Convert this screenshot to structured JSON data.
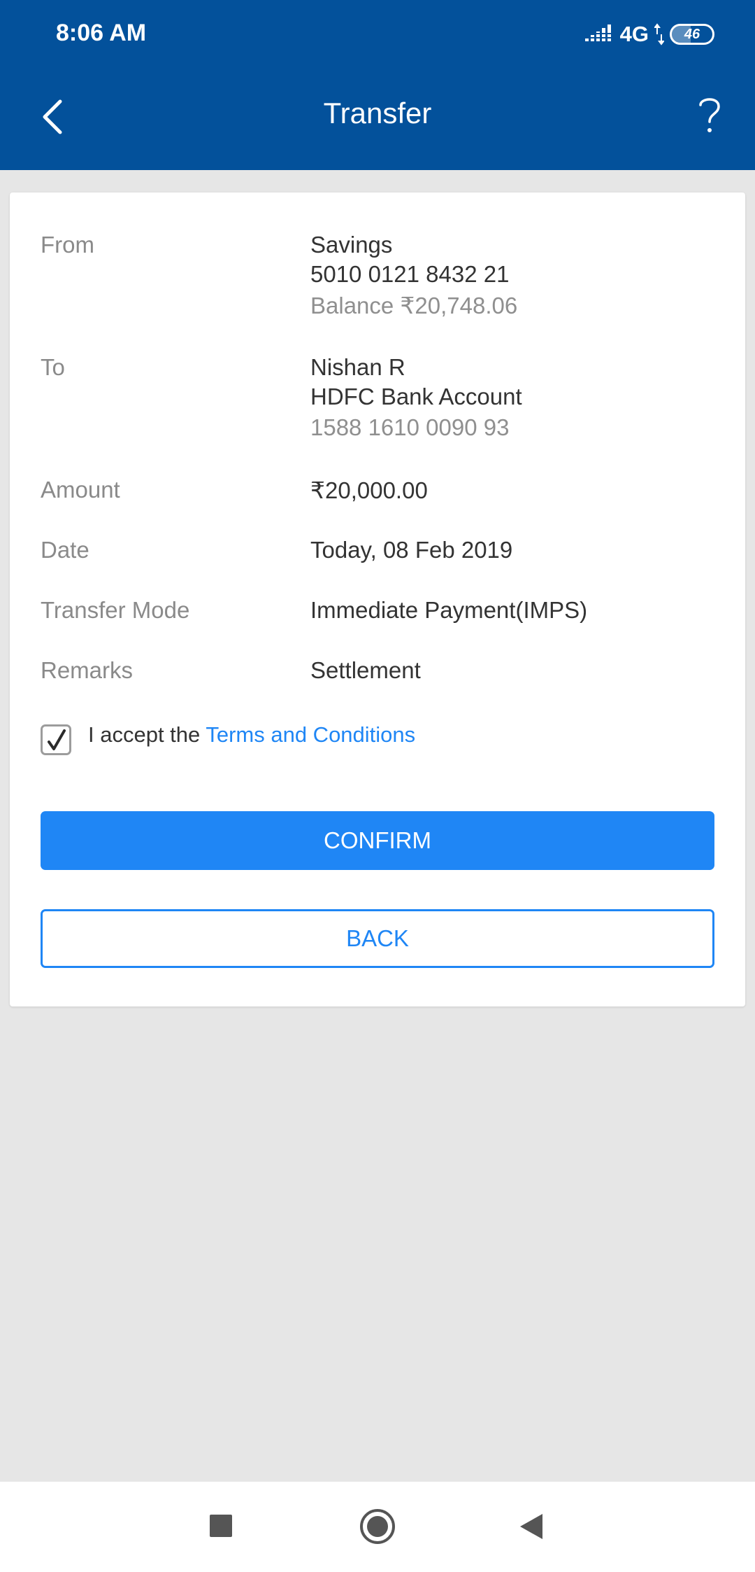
{
  "status_bar": {
    "time": "8:06 AM",
    "network": "4G",
    "battery": "46"
  },
  "header": {
    "title": "Transfer"
  },
  "transfer": {
    "from": {
      "label": "From",
      "account_type": "Savings",
      "account_number": "5010 0121 8432 21",
      "balance": "Balance ₹20,748.06"
    },
    "to": {
      "label": "To",
      "name": "Nishan R",
      "bank": "HDFC Bank Account",
      "account_number": "1588 1610 0090 93"
    },
    "amount": {
      "label": "Amount",
      "value": "₹20,000.00"
    },
    "date": {
      "label": "Date",
      "value": "Today, 08 Feb 2019"
    },
    "mode": {
      "label": "Transfer Mode",
      "value": "Immediate Payment(IMPS)"
    },
    "remarks": {
      "label": "Remarks",
      "value": "Settlement"
    }
  },
  "terms": {
    "checked": true,
    "prefix": "I accept the",
    "link": "Terms and Conditions"
  },
  "buttons": {
    "confirm": "CONFIRM",
    "back": "BACK"
  },
  "colors": {
    "header": "#03519b",
    "accent": "#1f86f5",
    "background": "#e6e6e6"
  }
}
